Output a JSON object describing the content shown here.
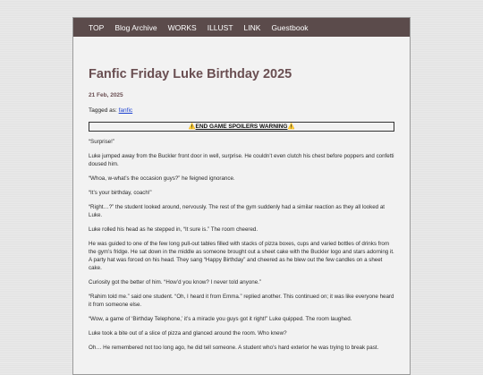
{
  "nav": [
    "TOP",
    "Blog Archive",
    "WORKS",
    "ILLUST",
    "LINK",
    "Guestbook"
  ],
  "post": {
    "title": "Fanfic Friday Luke Birthday 2025",
    "date": "21 Feb, 2025",
    "tags_label": "Tagged as:",
    "tag": "fanfic",
    "warning_icon": "⚠️",
    "warning": "END GAME SPOILERS WARNING",
    "paragraphs": [
      "“Surprise!”",
      "Luke jumped away from the Buckler front door in well, surprise. He couldn’t even clutch his chest before poppers and confetti doused him.",
      "“Whoa, w-what’s the occasion guys?” he feigned ignorance.",
      "“It’s your birthday, coach!”",
      "“Right…?” the student looked around, nervously. The rest of the gym suddenly had a similar reaction as they all looked at Luke.",
      "Luke rolled his head as he stepped in, “It sure is.” The room cheered.",
      "He was guided to one of the few long pull-out tables filled with stacks of pizza boxes, cups and varied bottles of drinks from the gym’s fridge. He sat down in the middle as someone brought out a sheet cake with the Buckler logo and stars adorning it. A party hat was forced on his head. They sang “Happy Birthday” and cheered as he blew out the few candles on a sheet cake.",
      "Curiosity got the better of him. “How’d you know? I never told anyone.”",
      "“Rahim told me.” said one student. “Oh, I heard it from Emma.” replied another. This continued on; it was like everyone heard it from someone else.",
      "“Wow, a game of ‘Birthday Telephone,’ it’s a miracle you guys got it right!” Luke quipped. The room laughed.",
      "Luke took a bite out of a slice of pizza and glanced around the room. Who knew?",
      "Oh… He remembered not too long ago, he did tell someone. A student who’s hard exterior he was trying to break past."
    ]
  }
}
